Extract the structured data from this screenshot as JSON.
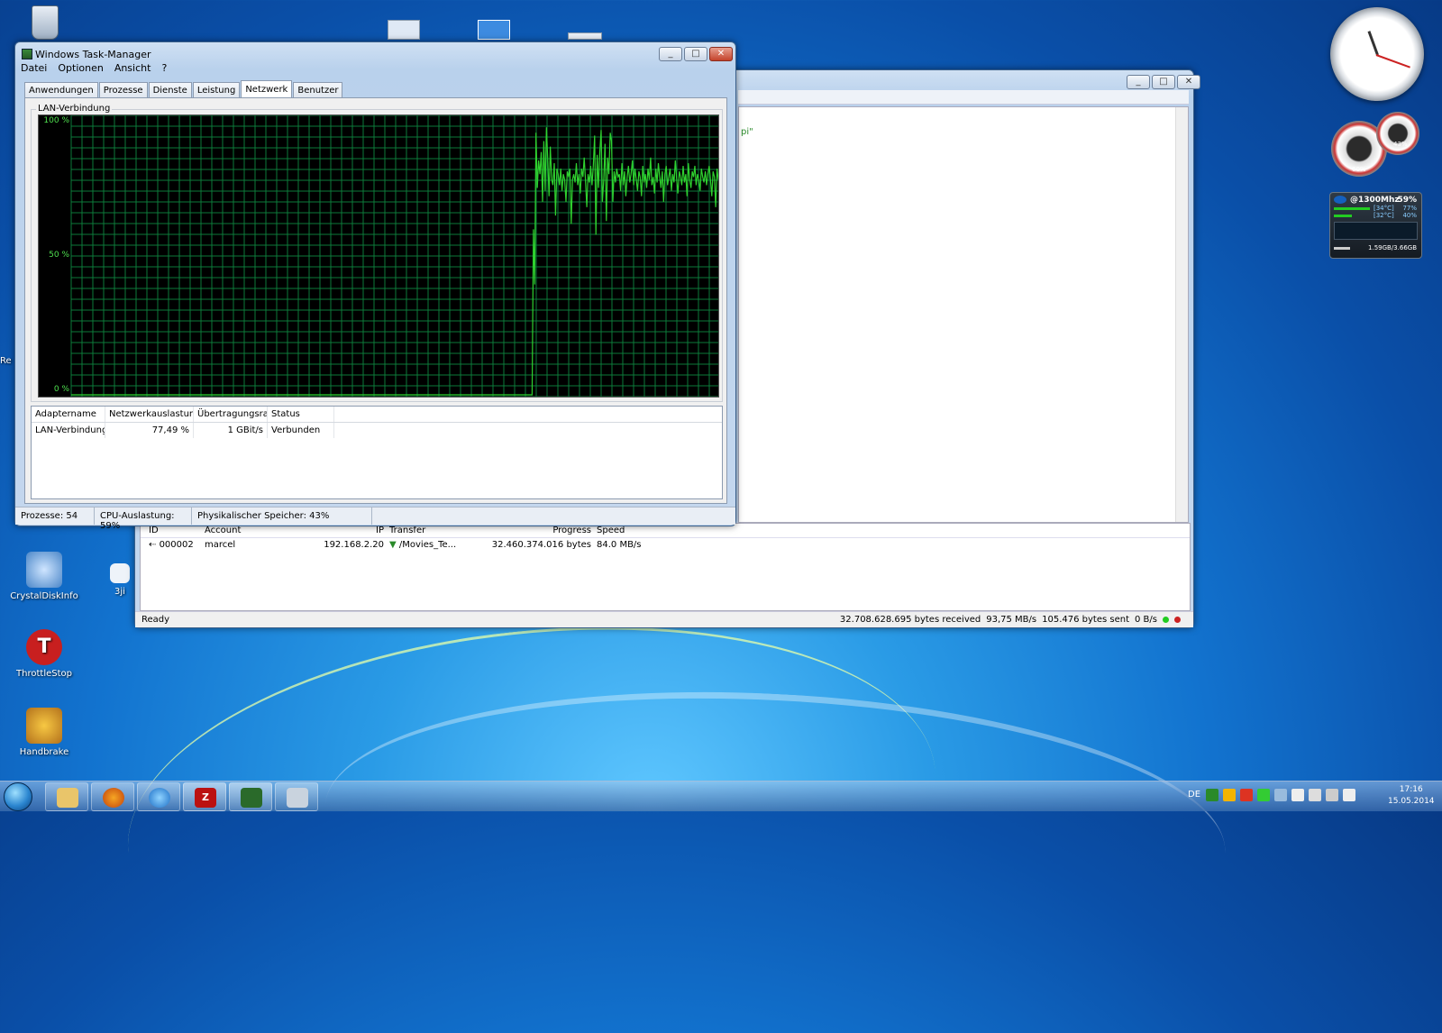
{
  "desktop": {
    "icons": [
      {
        "label": "CrystalDiskInfo"
      },
      {
        "label": "ThrottleStop"
      },
      {
        "label": "Handbrake"
      },
      {
        "label": "Re"
      },
      {
        "label": "3ji"
      }
    ]
  },
  "taskmanager": {
    "title": "Windows Task-Manager",
    "menu": [
      "Datei",
      "Optionen",
      "Ansicht",
      "?"
    ],
    "tabs": [
      "Anwendungen",
      "Prozesse",
      "Dienste",
      "Leistung",
      "Netzwerk",
      "Benutzer"
    ],
    "active_tab": "Netzwerk",
    "graph": {
      "label": "LAN-Verbindung",
      "y_top": "100 %",
      "y_mid": "50 %",
      "y_bottom": "0 %",
      "line_color": "#2fd12f",
      "grid_color": "#0d7a3a",
      "utilization_percent": [
        0,
        0,
        0,
        0,
        0,
        0,
        0,
        0,
        0,
        0,
        0,
        0,
        0,
        0,
        0,
        0,
        0,
        0,
        0,
        0,
        0,
        0,
        0,
        0,
        0,
        0,
        0,
        0,
        0,
        0,
        0,
        0,
        0,
        0,
        0,
        0,
        0,
        0,
        0,
        0,
        0,
        0,
        0,
        0,
        0,
        0,
        0,
        0,
        0,
        0,
        0,
        0,
        0,
        0,
        0,
        0,
        0,
        0,
        0,
        0,
        0,
        0,
        0,
        0,
        0,
        0,
        0,
        0,
        0,
        0,
        0,
        0,
        0,
        0,
        0,
        0,
        0,
        0,
        0,
        0,
        0,
        0,
        0,
        0,
        0,
        0,
        0,
        0,
        0,
        0,
        0,
        0,
        0,
        0,
        0,
        0,
        0,
        0,
        0,
        0,
        0,
        0,
        0,
        0,
        0,
        0,
        0,
        0,
        0,
        0,
        0,
        0,
        0,
        0,
        0,
        0,
        0,
        0,
        0,
        0,
        0,
        0,
        0,
        0,
        0,
        0,
        0,
        0,
        0,
        0,
        0,
        0,
        0,
        0,
        0,
        0,
        0,
        0,
        0,
        0,
        0,
        0,
        0,
        0,
        0,
        0,
        0,
        0,
        0,
        0,
        0,
        0,
        0,
        0,
        0,
        0,
        0,
        0,
        0,
        0,
        0,
        0,
        0,
        0,
        0,
        0,
        0,
        0,
        0,
        0,
        0,
        0,
        0,
        0,
        0,
        0,
        0,
        0,
        0,
        0,
        0,
        0,
        0,
        0,
        0,
        0,
        0,
        0,
        0,
        0,
        0,
        0,
        0,
        0,
        0,
        0,
        0,
        0,
        0,
        0,
        0,
        0,
        0,
        0,
        0,
        0,
        0,
        0,
        0,
        0,
        0,
        0,
        0,
        0,
        0,
        0,
        0,
        0,
        0,
        0,
        0,
        0,
        0,
        0,
        0,
        0,
        0,
        0,
        0,
        0,
        0,
        0,
        0,
        0,
        0,
        0,
        0,
        0,
        0,
        0,
        0,
        0,
        0,
        0,
        0,
        0,
        0,
        0,
        0,
        0,
        0,
        0,
        0,
        0,
        0,
        0,
        0,
        0,
        0,
        0,
        0,
        0,
        0,
        0,
        0,
        0,
        0,
        0,
        0,
        0,
        0,
        0,
        0,
        0,
        0,
        0,
        0,
        0,
        0,
        0,
        0,
        0,
        0,
        0,
        0,
        0,
        0,
        0,
        0,
        0,
        0,
        0,
        0,
        0,
        0,
        0,
        0,
        0,
        0,
        0,
        0,
        0,
        0,
        0,
        0,
        0,
        0,
        0,
        0,
        0,
        0,
        0,
        0,
        0,
        0,
        0,
        0,
        0,
        0,
        0,
        0,
        0,
        0,
        0,
        0,
        0,
        0,
        0,
        0,
        0,
        0,
        0,
        0,
        0,
        0,
        0,
        0,
        0,
        0,
        0,
        0,
        0,
        0,
        0,
        0,
        0,
        0,
        0,
        0,
        0,
        0,
        0,
        0,
        0,
        0,
        60,
        40,
        95,
        75,
        85,
        80,
        88,
        70,
        92,
        74,
        97,
        86,
        72,
        90,
        78,
        76,
        84,
        65,
        82,
        80,
        76,
        82,
        74,
        80,
        78,
        70,
        81,
        79,
        82,
        62,
        78,
        80,
        77,
        84,
        76,
        80,
        73,
        82,
        79,
        86,
        78,
        68,
        80,
        77,
        83,
        76,
        83,
        94,
        58,
        87,
        75,
        88,
        96,
        70,
        78,
        91,
        63,
        86,
        80,
        95,
        92,
        70,
        81,
        77,
        82,
        79,
        80,
        74,
        84,
        76,
        81,
        72,
        79,
        83,
        77,
        80,
        85,
        76,
        82,
        78,
        74,
        81,
        79,
        72,
        83,
        77,
        80,
        75,
        82,
        78,
        86,
        76,
        79,
        73,
        82,
        77,
        84,
        79,
        75,
        81,
        70,
        80,
        83,
        76,
        79,
        82,
        74,
        80,
        77,
        85,
        78,
        73,
        81,
        79,
        76,
        83,
        77,
        80,
        72,
        84,
        78,
        75,
        81,
        79,
        83,
        76,
        80,
        78,
        74,
        82,
        79,
        77,
        81,
        76,
        80,
        83,
        78,
        72,
        81,
        79,
        68,
        82,
        78
      ]
    },
    "columns": [
      "Adaptername",
      "Netzwerkauslastung",
      "Übertragungsrate",
      "Status"
    ],
    "rows": [
      {
        "name": "LAN-Verbindung",
        "util": "77,49 %",
        "rate": "1 GBit/s",
        "status": "Verbunden"
      }
    ],
    "statusbar": {
      "processes": "Prozesse: 54",
      "cpu": "CPU-Auslastung: 59%",
      "memory": "Physikalischer Speicher: 43%"
    }
  },
  "filezilla": {
    "snippet": "pi\"",
    "queue_columns": [
      "ID",
      "Account",
      "IP",
      "Transfer",
      "Progress",
      "Speed"
    ],
    "queue_rows": [
      {
        "id": "000002",
        "account": "marcel",
        "ip": "192.168.2.20",
        "transfer": "/Movies_Te...",
        "progress": "32.460.374.016 bytes",
        "speed": "84.0 MB/s"
      }
    ],
    "status_ready": "Ready",
    "received": "32.708.628.695 bytes received",
    "recv_speed": "93,75 MB/s",
    "sent": "105.476 bytes sent",
    "sent_speed": "0 B/s"
  },
  "gadgets": {
    "cpu_line": "@1300Mhz",
    "cpu_pct": "59%",
    "temp1": "[34°C]",
    "temp1_pct": "77%",
    "temp2": "[32°C]",
    "temp2_pct": "40%",
    "mem": "1.59GB/3.66GB",
    "meter1": "60%",
    "meter2": "43%"
  },
  "taskbar": {
    "lang": "DE",
    "time": "17:16",
    "date": "15.05.2014"
  }
}
